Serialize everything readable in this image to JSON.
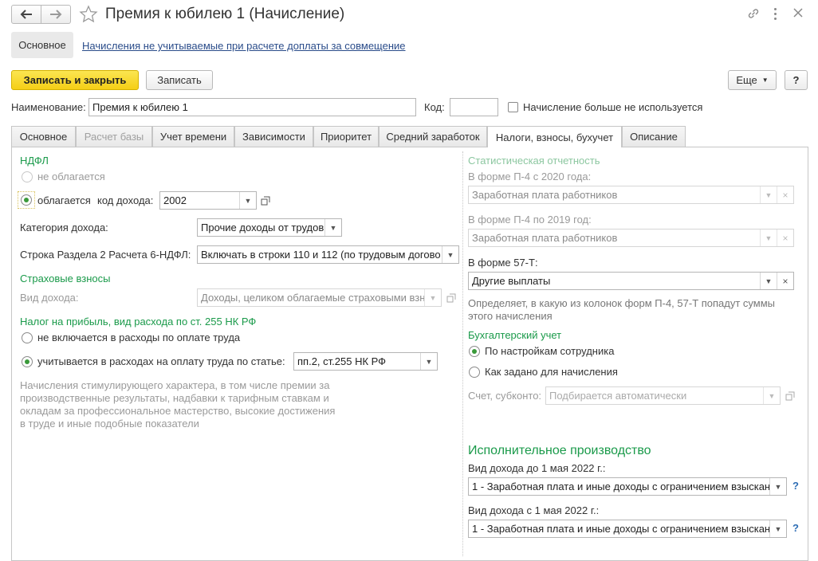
{
  "window": {
    "title": "Премия к юбилею 1 (Начисление)"
  },
  "top_nav": {
    "main_link": "Основное",
    "secondary_link": "Начисления не учитываемые при расчете доплаты за совмещение"
  },
  "toolbar": {
    "save_close": "Записать и закрыть",
    "save": "Записать",
    "more": "Еще",
    "help": "?"
  },
  "header_fields": {
    "name_label": "Наименование:",
    "name_value": "Премия к юбилею 1",
    "code_label": "Код:",
    "code_value": "",
    "not_used_label": "Начисление больше не используется"
  },
  "tabs": [
    {
      "label": "Основное",
      "state": "normal"
    },
    {
      "label": "Расчет базы",
      "state": "disabled"
    },
    {
      "label": "Учет времени",
      "state": "normal"
    },
    {
      "label": "Зависимости",
      "state": "normal"
    },
    {
      "label": "Приоритет",
      "state": "normal"
    },
    {
      "label": "Средний заработок",
      "state": "normal"
    },
    {
      "label": "Налоги, взносы, бухучет",
      "state": "active"
    },
    {
      "label": "Описание",
      "state": "normal"
    }
  ],
  "left": {
    "ndfl_title": "НДФЛ",
    "ndfl_not_taxed": "не облагается",
    "ndfl_taxed": "облагается",
    "income_code_label": "код дохода:",
    "income_code_value": "2002",
    "income_category_label": "Категория дохода:",
    "income_category_value": "Прочие доходы от трудов",
    "line_6ndfl_label": "Строка Раздела 2 Расчета 6-НДФЛ:",
    "line_6ndfl_value": "Включать в строки 110 и 112 (по трудовым догово",
    "insurance_title": "Страховые взносы",
    "income_type_label": "Вид дохода:",
    "income_type_value": "Доходы, целиком облагаемые страховыми взн",
    "profit_tax_title": "Налог на прибыль, вид расхода по ст. 255 НК РФ",
    "not_included": "не включается в расходы по оплате труда",
    "included": "учитывается в расходах на оплату труда по статье:",
    "article_value": "пп.2, ст.255 НК РФ",
    "note": [
      "Начисления стимулирующего характера, в том числе премии за",
      "производственные результаты, надбавки к тарифным ставкам и",
      "окладам за профессиональное мастерство, высокие достижения",
      "в труде и иные подобные показатели"
    ]
  },
  "right": {
    "stat_title": "Статистическая отчетность",
    "p4_2020_label": "В форме П-4 с 2020 года:",
    "p4_2020_value": "Заработная плата работников",
    "p4_2019_label": "В форме П-4 по 2019 год:",
    "p4_2019_value": "Заработная плата работников",
    "f57t_label": "В форме 57-Т:",
    "f57t_value": "Другие выплаты",
    "f57t_note": [
      "Определяет, в какую из колонок форм П-4, 57-Т попадут суммы",
      "этого начисления"
    ],
    "acc_title": "Бухгалтерский учет",
    "acc_employee": "По настройкам сотрудника",
    "acc_accrual": "Как задано для начисления",
    "account_label": "Счет, субконто:",
    "account_placeholder": "Подбирается автоматически",
    "enforcement_title": "Исполнительное производство",
    "income_before_label": "Вид дохода до 1 мая 2022 г.:",
    "income_before_value": "1 - Заработная плата и иные доходы с ограничением взыскан",
    "income_after_label": "Вид дохода с 1 мая 2022 г.:",
    "income_after_value": "1 - Заработная плата и иные доходы с ограничением взыскан",
    "help_q": "?"
  }
}
